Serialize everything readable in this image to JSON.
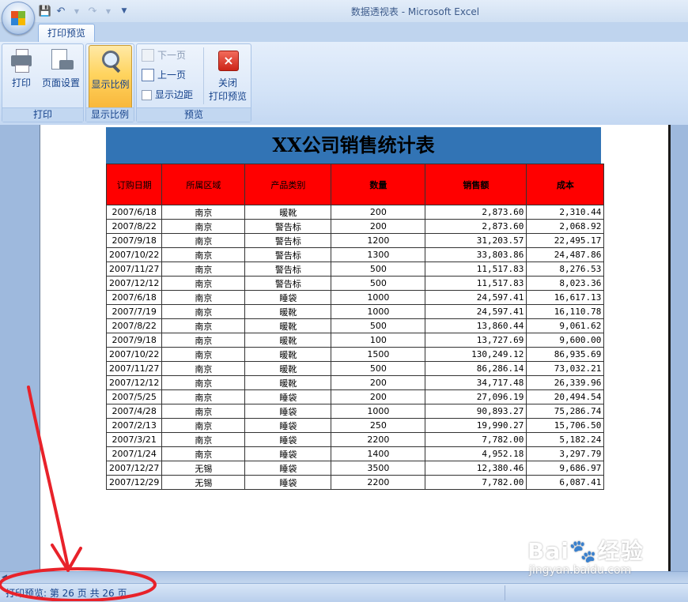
{
  "window": {
    "title": "数据透视表 - Microsoft Excel"
  },
  "qat": {
    "icons": [
      "save-icon",
      "undo-icon",
      "redo-icon",
      "customize-icon"
    ]
  },
  "ribbon": {
    "tab": "打印预览",
    "groups": {
      "print": {
        "label": "打印",
        "print_btn": "打印",
        "page_setup_btn": "页面设置"
      },
      "zoom": {
        "label": "显示比例",
        "zoom_btn": "显示比例"
      },
      "preview": {
        "label": "预览",
        "next_page": "下一页",
        "prev_page": "上一页",
        "show_margins": "显示边距",
        "close_label_1": "关闭",
        "close_label_2": "打印预览"
      }
    }
  },
  "sheet": {
    "title": "XX公司销售统计表",
    "headers": [
      "订购日期",
      "所属区域",
      "产品类别",
      "数量",
      "销售额",
      "成本"
    ],
    "rows": [
      [
        "2007/6/18",
        "南京",
        "暖靴",
        "200",
        "2,873.60",
        "2,310.44"
      ],
      [
        "2007/8/22",
        "南京",
        "警告标",
        "200",
        "2,873.60",
        "2,068.92"
      ],
      [
        "2007/9/18",
        "南京",
        "警告标",
        "1200",
        "31,203.57",
        "22,495.17"
      ],
      [
        "2007/10/22",
        "南京",
        "警告标",
        "1300",
        "33,803.86",
        "24,487.86"
      ],
      [
        "2007/11/27",
        "南京",
        "警告标",
        "500",
        "11,517.83",
        "8,276.53"
      ],
      [
        "2007/12/12",
        "南京",
        "警告标",
        "500",
        "11,517.83",
        "8,023.36"
      ],
      [
        "2007/6/18",
        "南京",
        "睡袋",
        "1000",
        "24,597.41",
        "16,617.13"
      ],
      [
        "2007/7/19",
        "南京",
        "暖靴",
        "1000",
        "24,597.41",
        "16,110.78"
      ],
      [
        "2007/8/22",
        "南京",
        "暖靴",
        "500",
        "13,860.44",
        "9,061.62"
      ],
      [
        "2007/9/18",
        "南京",
        "暖靴",
        "100",
        "13,727.69",
        "9,600.00"
      ],
      [
        "2007/10/22",
        "南京",
        "暖靴",
        "1500",
        "130,249.12",
        "86,935.69"
      ],
      [
        "2007/11/27",
        "南京",
        "暖靴",
        "500",
        "86,286.14",
        "73,032.21"
      ],
      [
        "2007/12/12",
        "南京",
        "暖靴",
        "200",
        "34,717.48",
        "26,339.96"
      ],
      [
        "2007/5/25",
        "南京",
        "睡袋",
        "200",
        "27,096.19",
        "20,494.54"
      ],
      [
        "2007/4/28",
        "南京",
        "睡袋",
        "1000",
        "90,893.27",
        "75,286.74"
      ],
      [
        "2007/2/13",
        "南京",
        "睡袋",
        "250",
        "19,990.27",
        "15,706.50"
      ],
      [
        "2007/3/21",
        "南京",
        "睡袋",
        "2200",
        "7,782.00",
        "5,182.24"
      ],
      [
        "2007/1/24",
        "南京",
        "睡袋",
        "1400",
        "4,952.18",
        "3,297.79"
      ],
      [
        "2007/12/27",
        "无锡",
        "睡袋",
        "3500",
        "12,380.46",
        "9,686.97"
      ],
      [
        "2007/12/29",
        "无锡",
        "睡袋",
        "2200",
        "7,782.00",
        "6,087.41"
      ]
    ]
  },
  "status": {
    "text": "打印预览: 第 26 页 共 26 页"
  },
  "watermark": {
    "logo": "Bai🐾经验",
    "url": "jingyan.baidu.com"
  },
  "colors": {
    "header_fill": "#ff0000",
    "title_fill": "#3274b5",
    "annotation": "#e8222a"
  }
}
